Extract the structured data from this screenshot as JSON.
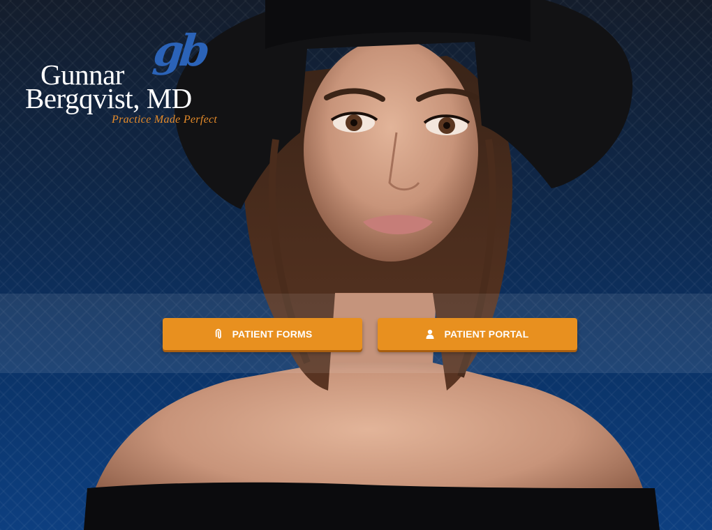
{
  "logo": {
    "monogram": "gb",
    "name_line1": "Gunnar",
    "name_line2": "Bergqvist, MD",
    "tagline": "Practice Made Perfect"
  },
  "hero": {
    "photo": "woman in black wide-brim hat and off-shoulder top"
  },
  "actions": {
    "patient_forms": {
      "label": "PATIENT FORMS",
      "icon": "paperclip-icon"
    },
    "patient_portal": {
      "label": "PATIENT PORTAL",
      "icon": "user-icon"
    }
  },
  "colors": {
    "background_top": "#141d2c",
    "background_bottom": "#0d3f80",
    "button": "#e8901f",
    "monogram": "#2b63b8",
    "tagline": "#e58b2a"
  }
}
